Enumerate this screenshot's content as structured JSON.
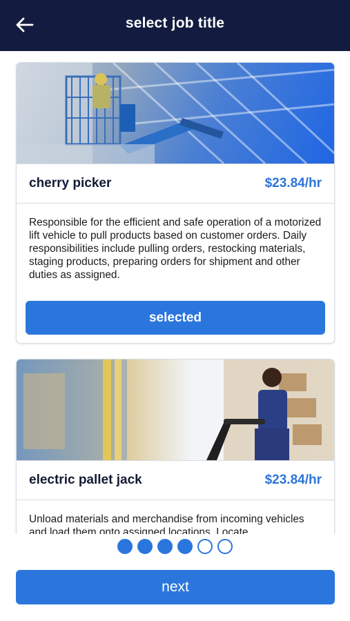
{
  "header": {
    "title": "select job title",
    "back_icon": "arrow-left-icon"
  },
  "jobs": [
    {
      "name": "cherry picker",
      "rate": "$23.84/hr",
      "description": "Responsible for the efficient and safe operation of a motorized lift vehicle to pull products based on customer orders. Daily responsibilities include pulling orders, restocking materials, staging products, preparing orders for shipment and other duties as assigned.",
      "button_label": "selected"
    },
    {
      "name": "electric pallet jack",
      "rate": "$23.84/hr",
      "description": "Unload materials and merchandise from incoming vehicles and load them onto assigned locations. Locate"
    }
  ],
  "pager": {
    "total": 6,
    "filled": 4
  },
  "footer": {
    "next_label": "next"
  },
  "colors": {
    "header_bg": "#131c40",
    "accent": "#2b76dc",
    "rate_text": "#2d74d8"
  }
}
